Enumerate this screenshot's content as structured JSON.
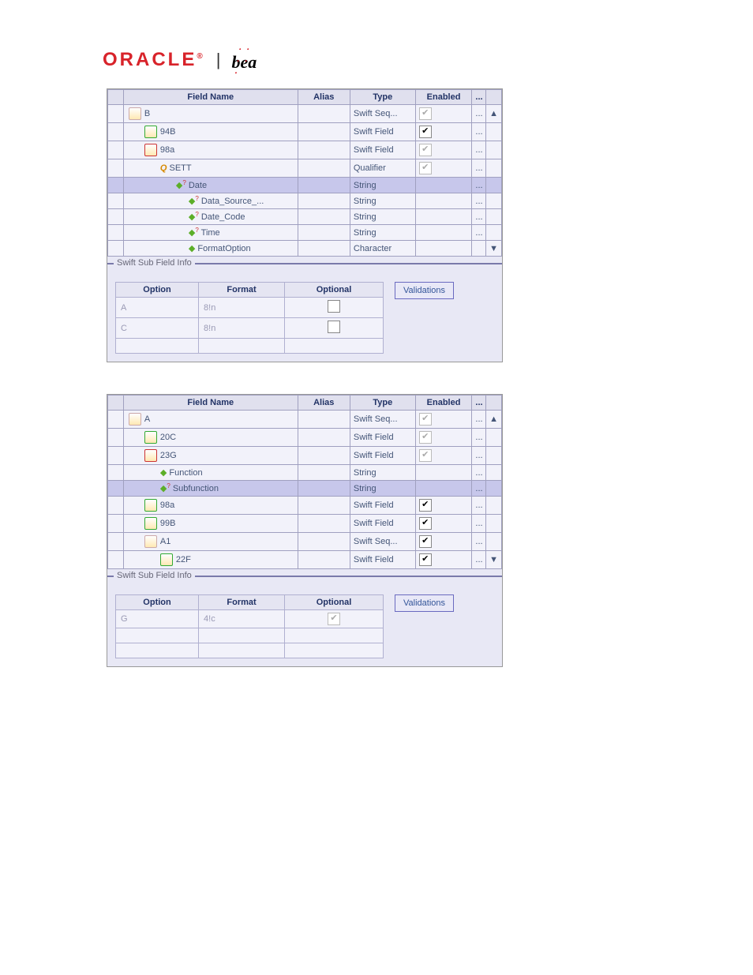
{
  "brand": {
    "oracle": "ORACLE",
    "reg": "®",
    "pipe": "|",
    "bea": "bea"
  },
  "table_headers": {
    "empty": "",
    "field_name": "Field Name",
    "alias": "Alias",
    "type": "Type",
    "enabled": "Enabled",
    "dots": "..."
  },
  "panel1": {
    "rows": [
      {
        "indent": 0,
        "icon": "folder",
        "name": "B",
        "type": "Swift Seq...",
        "enabled": "dim",
        "dots": "..."
      },
      {
        "indent": 1,
        "icon": "fld",
        "name": "94B",
        "type": "Swift Field",
        "enabled": "check",
        "dots": "..."
      },
      {
        "indent": 1,
        "icon": "fldopen",
        "name": "98a",
        "type": "Swift Field",
        "enabled": "dim",
        "dots": "..."
      },
      {
        "indent": 2,
        "icon": "q",
        "name": "SETT",
        "type": "Qualifier",
        "enabled": "dim",
        "dots": "..."
      },
      {
        "indent": 3,
        "icon": "diamondq",
        "name": "Date",
        "type": "String",
        "enabled": "",
        "dots": "...",
        "selected": true
      },
      {
        "indent": 4,
        "icon": "diamondq",
        "name": "Data_Source_...",
        "type": "String",
        "enabled": "",
        "dots": "..."
      },
      {
        "indent": 4,
        "icon": "diamondq",
        "name": "Date_Code",
        "type": "String",
        "enabled": "",
        "dots": "..."
      },
      {
        "indent": 4,
        "icon": "diamondq",
        "name": "Time",
        "type": "String",
        "enabled": "",
        "dots": "..."
      },
      {
        "indent": 4,
        "icon": "diamond",
        "name": "FormatOption",
        "type": "Character",
        "enabled": "",
        "dots": ""
      }
    ],
    "info_legend": "Swift Sub Field Info",
    "info_headers": {
      "option": "Option",
      "format": "Format",
      "optional": "Optional"
    },
    "info_rows": [
      {
        "option": "A",
        "format": "8!n",
        "optional": ""
      },
      {
        "option": "C",
        "format": "8!n",
        "optional": ""
      }
    ],
    "validations_btn": "Validations"
  },
  "panel2": {
    "rows": [
      {
        "indent": 0,
        "icon": "folder",
        "name": "A",
        "type": "Swift Seq...",
        "enabled": "dim",
        "dots": "..."
      },
      {
        "indent": 1,
        "icon": "fld",
        "name": "20C",
        "type": "Swift Field",
        "enabled": "dim",
        "dots": "..."
      },
      {
        "indent": 1,
        "icon": "fldopen",
        "name": "23G",
        "type": "Swift Field",
        "enabled": "dim",
        "dots": "..."
      },
      {
        "indent": 2,
        "icon": "diamond",
        "name": "Function",
        "type": "String",
        "enabled": "",
        "dots": "..."
      },
      {
        "indent": 2,
        "icon": "diamondq",
        "name": "Subfunction",
        "type": "String",
        "enabled": "",
        "dots": "...",
        "selected": true
      },
      {
        "indent": 1,
        "icon": "fld",
        "name": "98a",
        "type": "Swift Field",
        "enabled": "check",
        "dots": "..."
      },
      {
        "indent": 1,
        "icon": "fld",
        "name": "99B",
        "type": "Swift Field",
        "enabled": "check",
        "dots": "..."
      },
      {
        "indent": 1,
        "icon": "folder",
        "name": "A1",
        "type": "Swift Seq...",
        "enabled": "check",
        "dots": "..."
      },
      {
        "indent": 2,
        "icon": "fld",
        "name": "22F",
        "type": "Swift Field",
        "enabled": "check",
        "dots": "..."
      }
    ],
    "info_legend": "Swift Sub Field Info",
    "info_headers": {
      "option": "Option",
      "format": "Format",
      "optional": "Optional"
    },
    "info_rows": [
      {
        "option": "G",
        "format": "4!c",
        "optional": "dim"
      }
    ],
    "validations_btn": "Validations"
  }
}
